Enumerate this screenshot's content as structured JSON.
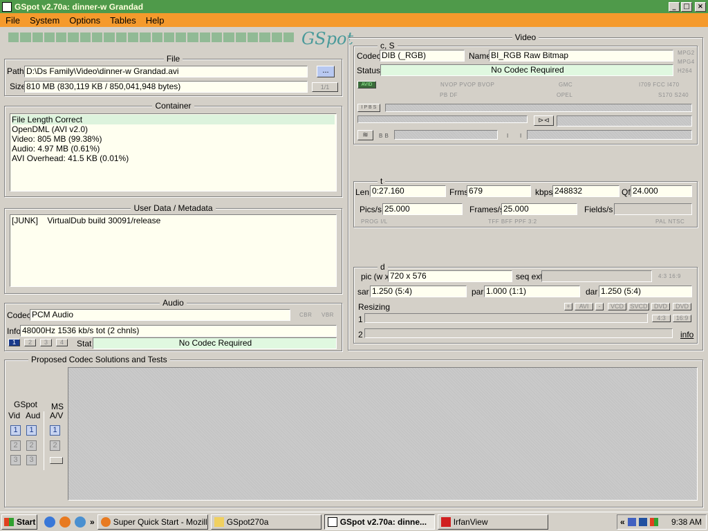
{
  "window": {
    "title": "GSpot v2.70a: dinner-w Grandad"
  },
  "menu": [
    "File",
    "System",
    "Options",
    "Tables",
    "Help"
  ],
  "logo_text": "GSpot",
  "file": {
    "title": "File",
    "path_label": "Path",
    "path_value": "D:\\Ds Family\\Video\\dinner-w Grandad.avi",
    "browse_label": "...",
    "size_label": "Size",
    "size_value": "810 MB (830,119 KB / 850,041,948 bytes)",
    "page_indicator": "1/1"
  },
  "container": {
    "title": "Container",
    "lines": [
      "File Length Correct",
      "OpenDML (AVI v2.0)",
      "Video: 805 MB (99.38%)",
      "Audio: 4.97 MB (0.61%)",
      "AVI Overhead: 41.5 KB (0.01%)"
    ]
  },
  "metadata": {
    "title": "User Data / Metadata",
    "tag": "[JUNK]",
    "value": "VirtualDub build 30091/release"
  },
  "audio": {
    "title": "Audio",
    "codec_label": "Codec",
    "codec_value": "PCM Audio",
    "cbr": "CBR",
    "vbr": "VBR",
    "info_label": "Info",
    "info_value": "48000Hz  1536 kb/s tot (2 chnls)",
    "stream_buttons": [
      "1",
      "2",
      "3",
      "4"
    ],
    "stat_label": "Stat",
    "stat_value": "No Codec Required"
  },
  "video": {
    "title": "Video",
    "cs_title": "c, S",
    "codec_label": "Codec",
    "codec_value": "DIB (_RGB)",
    "name_label": "Name",
    "name_value": "BI_RGB Raw Bitmap",
    "status_label": "Status",
    "status_value": "No Codec Required",
    "side_tags": [
      "MPG2",
      "MPG4",
      "H264"
    ],
    "avid": "AVID",
    "vop_tags": "NVOP  PVOP  BVOP",
    "pbdf": "PB DF",
    "gmc": "GMC",
    "opel": "OPEL",
    "itu": "I709  FCC  I470",
    "smpte": "S170  S240",
    "ipbs": "I P B S",
    "be": "B B",
    "i_marks": "I",
    "t_title": "t",
    "len_label": "Len",
    "len_value": "0:27.160",
    "frms_label": "Frms",
    "frms_value": "679",
    "kbps_label": "kbps",
    "kbps_value": "248832",
    "qf_label": "Qf",
    "qf_value": "24.000",
    "pics_label": "Pics/s",
    "pics_value": "25.000",
    "frames_label": "Frames/s",
    "frames_value": "25.000",
    "fields_label": "Fields/s",
    "fields_value": "",
    "prog": "PROG  I/L",
    "tff": "TFF  BFF  PPF  3:2",
    "pal": "PAL  NTSC",
    "d_title": "d",
    "pic_label": "pic (w x",
    "pic_value": "720 x 576",
    "seq_label": "seq ext",
    "ratio_tags": "4:3  16:9",
    "sar_label": "sar",
    "sar_value": "1.250 (5:4)",
    "par_label": "par",
    "par_value": "1.000 (1:1)",
    "dar_label": "dar",
    "dar_value": "1.250 (5:4)",
    "resizing_label": "Resizing",
    "resize_buttons": [
      "+",
      "AVI",
      "-",
      "VCD",
      "SVCD",
      "DVD",
      "DVD"
    ],
    "row1": "1",
    "row2": "2",
    "ratio_btn_1": "4:3",
    "ratio_btn_2": "16:9",
    "info_link": "info"
  },
  "proposed": {
    "title": "Proposed Codec Solutions and Tests",
    "gspot_label": "GSpot",
    "vid_label": "Vid",
    "aud_label": "Aud",
    "ms_label": "MS",
    "av_label": "A/V",
    "numbers": [
      "1",
      "2",
      "3"
    ]
  },
  "taskbar": {
    "start": "Start",
    "overflow": "»",
    "buttons": [
      "Super Quick Start - Mozill...",
      "GSpot270a",
      "GSpot v2.70a: dinne...",
      "IrfanView"
    ],
    "tray_arrow": "«",
    "clock": "9:38 AM"
  }
}
